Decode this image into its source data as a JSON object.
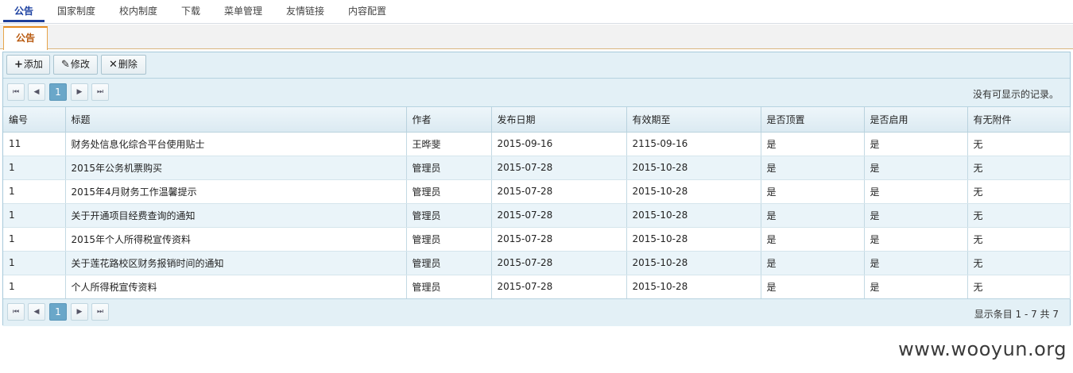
{
  "top_nav": {
    "items": [
      {
        "label": "公告",
        "active": true
      },
      {
        "label": "国家制度",
        "active": false
      },
      {
        "label": "校内制度",
        "active": false
      },
      {
        "label": "下载",
        "active": false
      },
      {
        "label": "菜单管理",
        "active": false
      },
      {
        "label": "友情链接",
        "active": false
      },
      {
        "label": "内容配置",
        "active": false
      }
    ]
  },
  "sub_tabs": [
    {
      "label": "公告",
      "active": true
    }
  ],
  "toolbar": {
    "add_label": "添加",
    "edit_label": "修改",
    "delete_label": "删除"
  },
  "pager_top": {
    "current_page": "1",
    "info": "没有可显示的记录。"
  },
  "pager_bottom": {
    "current_page": "1",
    "info": "显示条目 1 - 7 共 7"
  },
  "grid": {
    "columns": [
      "编号",
      "标题",
      "作者",
      "发布日期",
      "有效期至",
      "是否顶置",
      "是否启用",
      "有无附件"
    ],
    "rows": [
      [
        "11",
        "财务处信息化综合平台使用贴士",
        "王晔斐",
        "2015-09-16",
        "2115-09-16",
        "是",
        "是",
        "无"
      ],
      [
        "1",
        "2015年公务机票购买",
        "管理员",
        "2015-07-28",
        "2015-10-28",
        "是",
        "是",
        "无"
      ],
      [
        "1",
        "2015年4月财务工作温馨提示",
        "管理员",
        "2015-07-28",
        "2015-10-28",
        "是",
        "是",
        "无"
      ],
      [
        "1",
        "关于开通项目经费查询的通知",
        "管理员",
        "2015-07-28",
        "2015-10-28",
        "是",
        "是",
        "无"
      ],
      [
        "1",
        "2015年个人所得税宣传资料",
        "管理员",
        "2015-07-28",
        "2015-10-28",
        "是",
        "是",
        "无"
      ],
      [
        "1",
        "关于莲花路校区财务报销时间的通知",
        "管理员",
        "2015-07-28",
        "2015-10-28",
        "是",
        "是",
        "无"
      ],
      [
        "1",
        "个人所得税宣传资料",
        "管理员",
        "2015-07-28",
        "2015-10-28",
        "是",
        "是",
        "无"
      ]
    ]
  },
  "watermark": "www.wooyun.org",
  "colors": {
    "nav_active": "#1f3f9a",
    "tab_accent": "#e58a1f",
    "pager_current": "#6aa7c9"
  }
}
